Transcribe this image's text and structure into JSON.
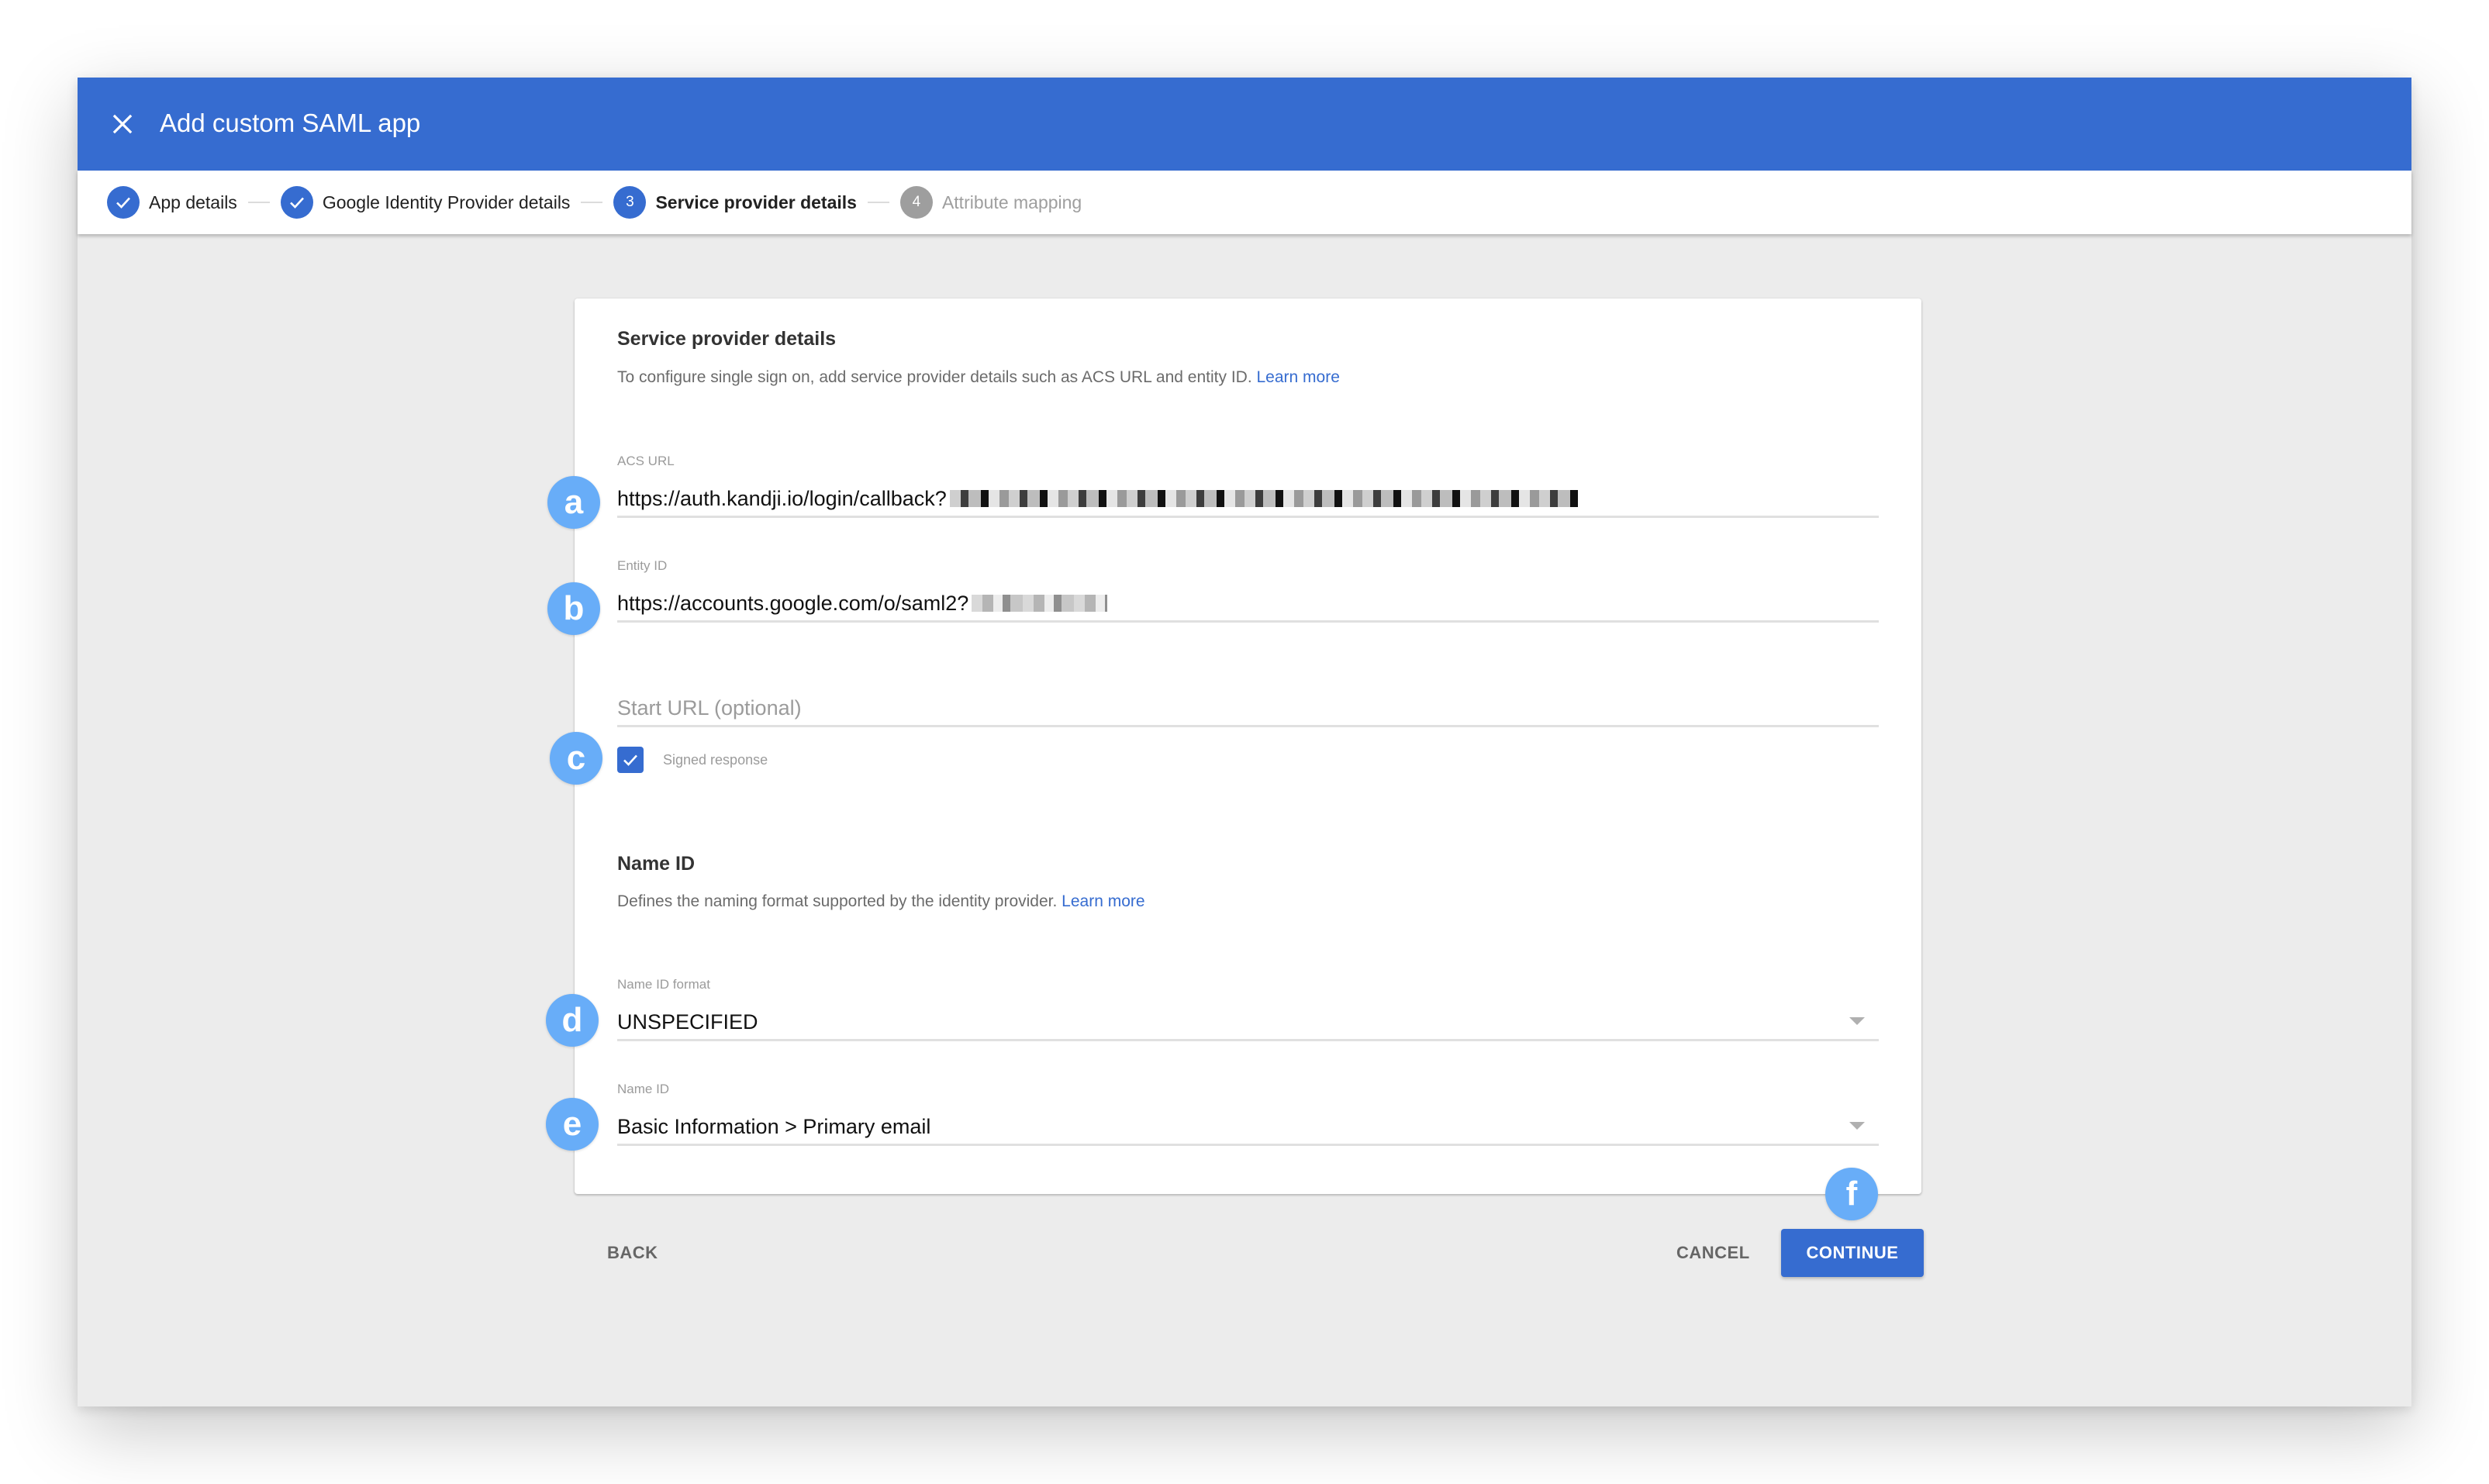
{
  "appbar": {
    "title": "Add custom SAML app",
    "close_icon": "close-icon",
    "color": "#366cd0"
  },
  "stepper": {
    "steps": [
      {
        "index": "1",
        "label": "App details",
        "state": "completed",
        "icon": "check-icon"
      },
      {
        "index": "2",
        "label": "Google Identity Provider details",
        "state": "completed",
        "icon": "check-icon"
      },
      {
        "index": "3",
        "label": "Service provider details",
        "state": "active"
      },
      {
        "index": "4",
        "label": "Attribute mapping",
        "state": "pending"
      }
    ]
  },
  "service_provider": {
    "title": "Service provider details",
    "description": "To configure single sign on, add service provider details such as ACS URL and entity ID.",
    "learn_more": "Learn more",
    "acs_url": {
      "label": "ACS URL",
      "value": "https://auth.kandji.io/login/callback?",
      "redacted_suffix": true
    },
    "entity_id": {
      "label": "Entity ID",
      "value": "https://accounts.google.com/o/saml2?",
      "redacted_suffix": true
    },
    "start_url": {
      "label": "",
      "placeholder": "Start URL (optional)",
      "value": ""
    },
    "signed_response": {
      "label": "Signed response",
      "checked": true
    }
  },
  "name_id": {
    "title": "Name ID",
    "description": "Defines the naming format supported by the identity provider.",
    "learn_more": "Learn more",
    "format": {
      "label": "Name ID format",
      "value": "UNSPECIFIED"
    },
    "name_id_field": {
      "label": "Name ID",
      "value": "Basic Information > Primary email"
    }
  },
  "annotations": {
    "a": "a",
    "b": "b",
    "c": "c",
    "d": "d",
    "e": "e",
    "f": "f",
    "color": "#68adf8"
  },
  "footer": {
    "back": "BACK",
    "cancel": "CANCEL",
    "continue": "CONTINUE"
  }
}
